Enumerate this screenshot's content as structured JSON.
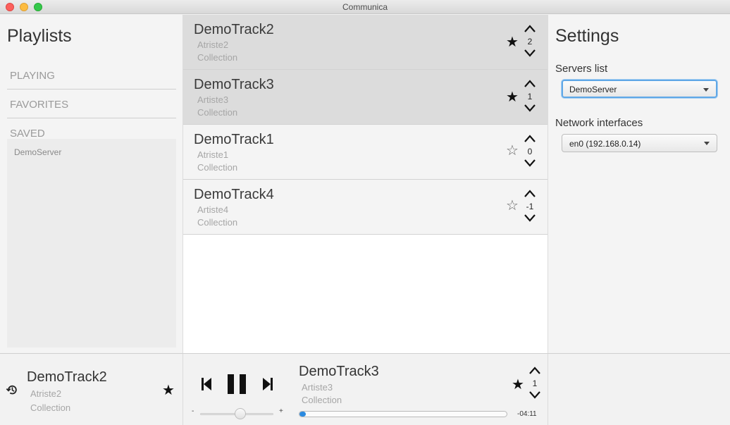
{
  "window": {
    "title": "Communica"
  },
  "playlists": {
    "title": "Playlists",
    "sections": [
      "PLAYING",
      "FAVORITES",
      "SAVED"
    ],
    "saved_items": [
      "DemoServer"
    ]
  },
  "tracks": [
    {
      "title": "DemoTrack2",
      "artist": "Atriste2",
      "collection": "Collection",
      "votes": "2",
      "favorite": true,
      "active": true
    },
    {
      "title": "DemoTrack3",
      "artist": "Artiste3",
      "collection": "Collection",
      "votes": "1",
      "favorite": true,
      "active": true
    },
    {
      "title": "DemoTrack1",
      "artist": "Atriste1",
      "collection": "Collection",
      "votes": "0",
      "favorite": false,
      "active": false
    },
    {
      "title": "DemoTrack4",
      "artist": "Artiste4",
      "collection": "Collection",
      "votes": "-1",
      "favorite": false,
      "active": false
    }
  ],
  "settings": {
    "title": "Settings",
    "servers_label": "Servers list",
    "servers_value": "DemoServer",
    "network_label": "Network interfaces",
    "network_value": "en0 (192.168.0.14)"
  },
  "player": {
    "previous": {
      "title": "DemoTrack2",
      "artist": "Atriste2",
      "collection": "Collection",
      "favorite": true
    },
    "current": {
      "title": "DemoTrack3",
      "artist": "Artiste3",
      "collection": "Collection",
      "votes": "1",
      "favorite": true
    },
    "volume_minus": "-",
    "volume_plus": "+",
    "volume_level": 0.55,
    "progress": 0.03,
    "time_left": "-04:11"
  },
  "icons": {
    "star": "star-icon",
    "upvote": "chevron-up-icon",
    "downvote": "chevron-down-icon",
    "history": "history-icon",
    "previous": "skip-previous-icon",
    "pause": "pause-icon",
    "next": "skip-next-icon"
  },
  "colors": {
    "accent": "#2b8ae0",
    "focus": "#5fa7e6",
    "active_row": "#dcdcdc"
  }
}
